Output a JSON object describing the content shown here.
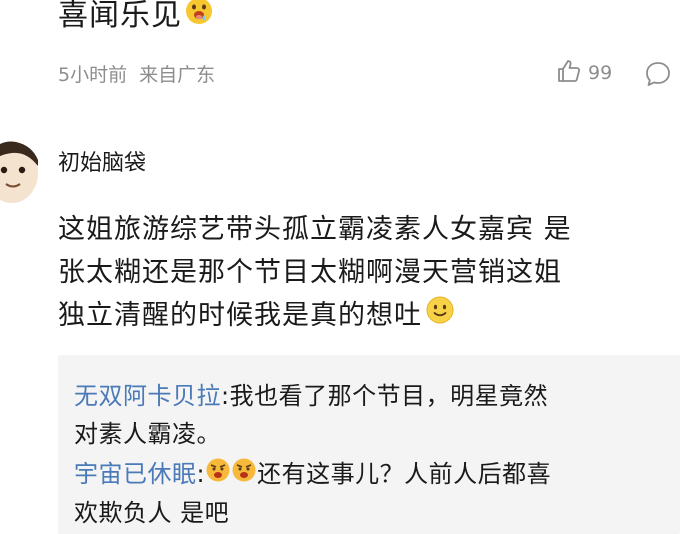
{
  "previous_comment": {
    "text": "喜闻乐见",
    "time": "5小时前",
    "location": "来自广东",
    "like_count": "99",
    "icons": [
      "like-icon",
      "comment-icon",
      "drool-emoji"
    ]
  },
  "comment": {
    "username": "初始脑袋",
    "lines": [
      "这姐旅游综艺带头孤立霸凌素人女嘉宾 是",
      "张太糊还是那个节目太糊啊漫天营销这姐",
      "独立清醒的时候我是真的想吐"
    ],
    "icons": [
      "smile-emoji",
      "avatar"
    ]
  },
  "replies": [
    {
      "name": "无双阿卡贝拉",
      "sep": ":",
      "line1": "我也看了那个节目，明星竟然",
      "line2": "对素人霸凌。"
    },
    {
      "name": "宇宙已休眠",
      "sep": ":",
      "line1": "还有这事儿？人前人后都喜",
      "line2": "欢欺负人 是吧",
      "icons": [
        "angry-emoji",
        "angry-emoji"
      ]
    }
  ],
  "colors": {
    "reply_name": "#4a7ab8",
    "meta_gray": "#8d8d8d",
    "reply_bg": "#f4f4f4"
  }
}
